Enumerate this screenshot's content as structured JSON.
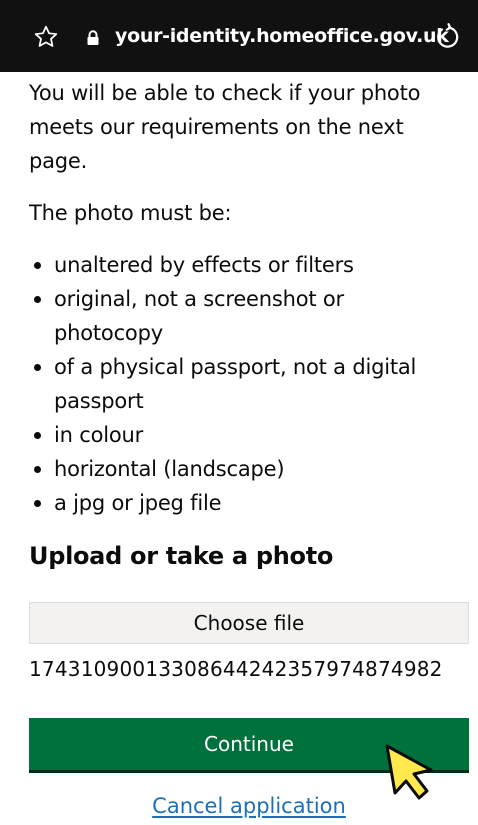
{
  "browser": {
    "url": "your-identity.homeoffice.gov.uk",
    "icons": {
      "bookmark": "star-outline-icon",
      "security": "lock-icon",
      "reload": "reload-icon"
    }
  },
  "page": {
    "intro": "You will be able to check if your photo meets our requirements on the next page.",
    "lead": "The photo must be:",
    "requirements": [
      "unaltered by effects or filters",
      "original, not a screenshot or photocopy",
      "of a physical passport, not a digital passport",
      "in colour",
      "horizontal (landscape)",
      "a jpg or jpeg file"
    ],
    "upload_heading": "Upload or take a photo",
    "choose_file_label": "Choose file",
    "selected_file_name": "17431090013308644242357974874982",
    "continue_label": "Continue",
    "cancel_link": "Cancel application"
  },
  "colors": {
    "continue_button": "#00703c",
    "link": "#1d70b8",
    "browser_bar": "#111111",
    "cursor_fill": "#ffe94d"
  }
}
